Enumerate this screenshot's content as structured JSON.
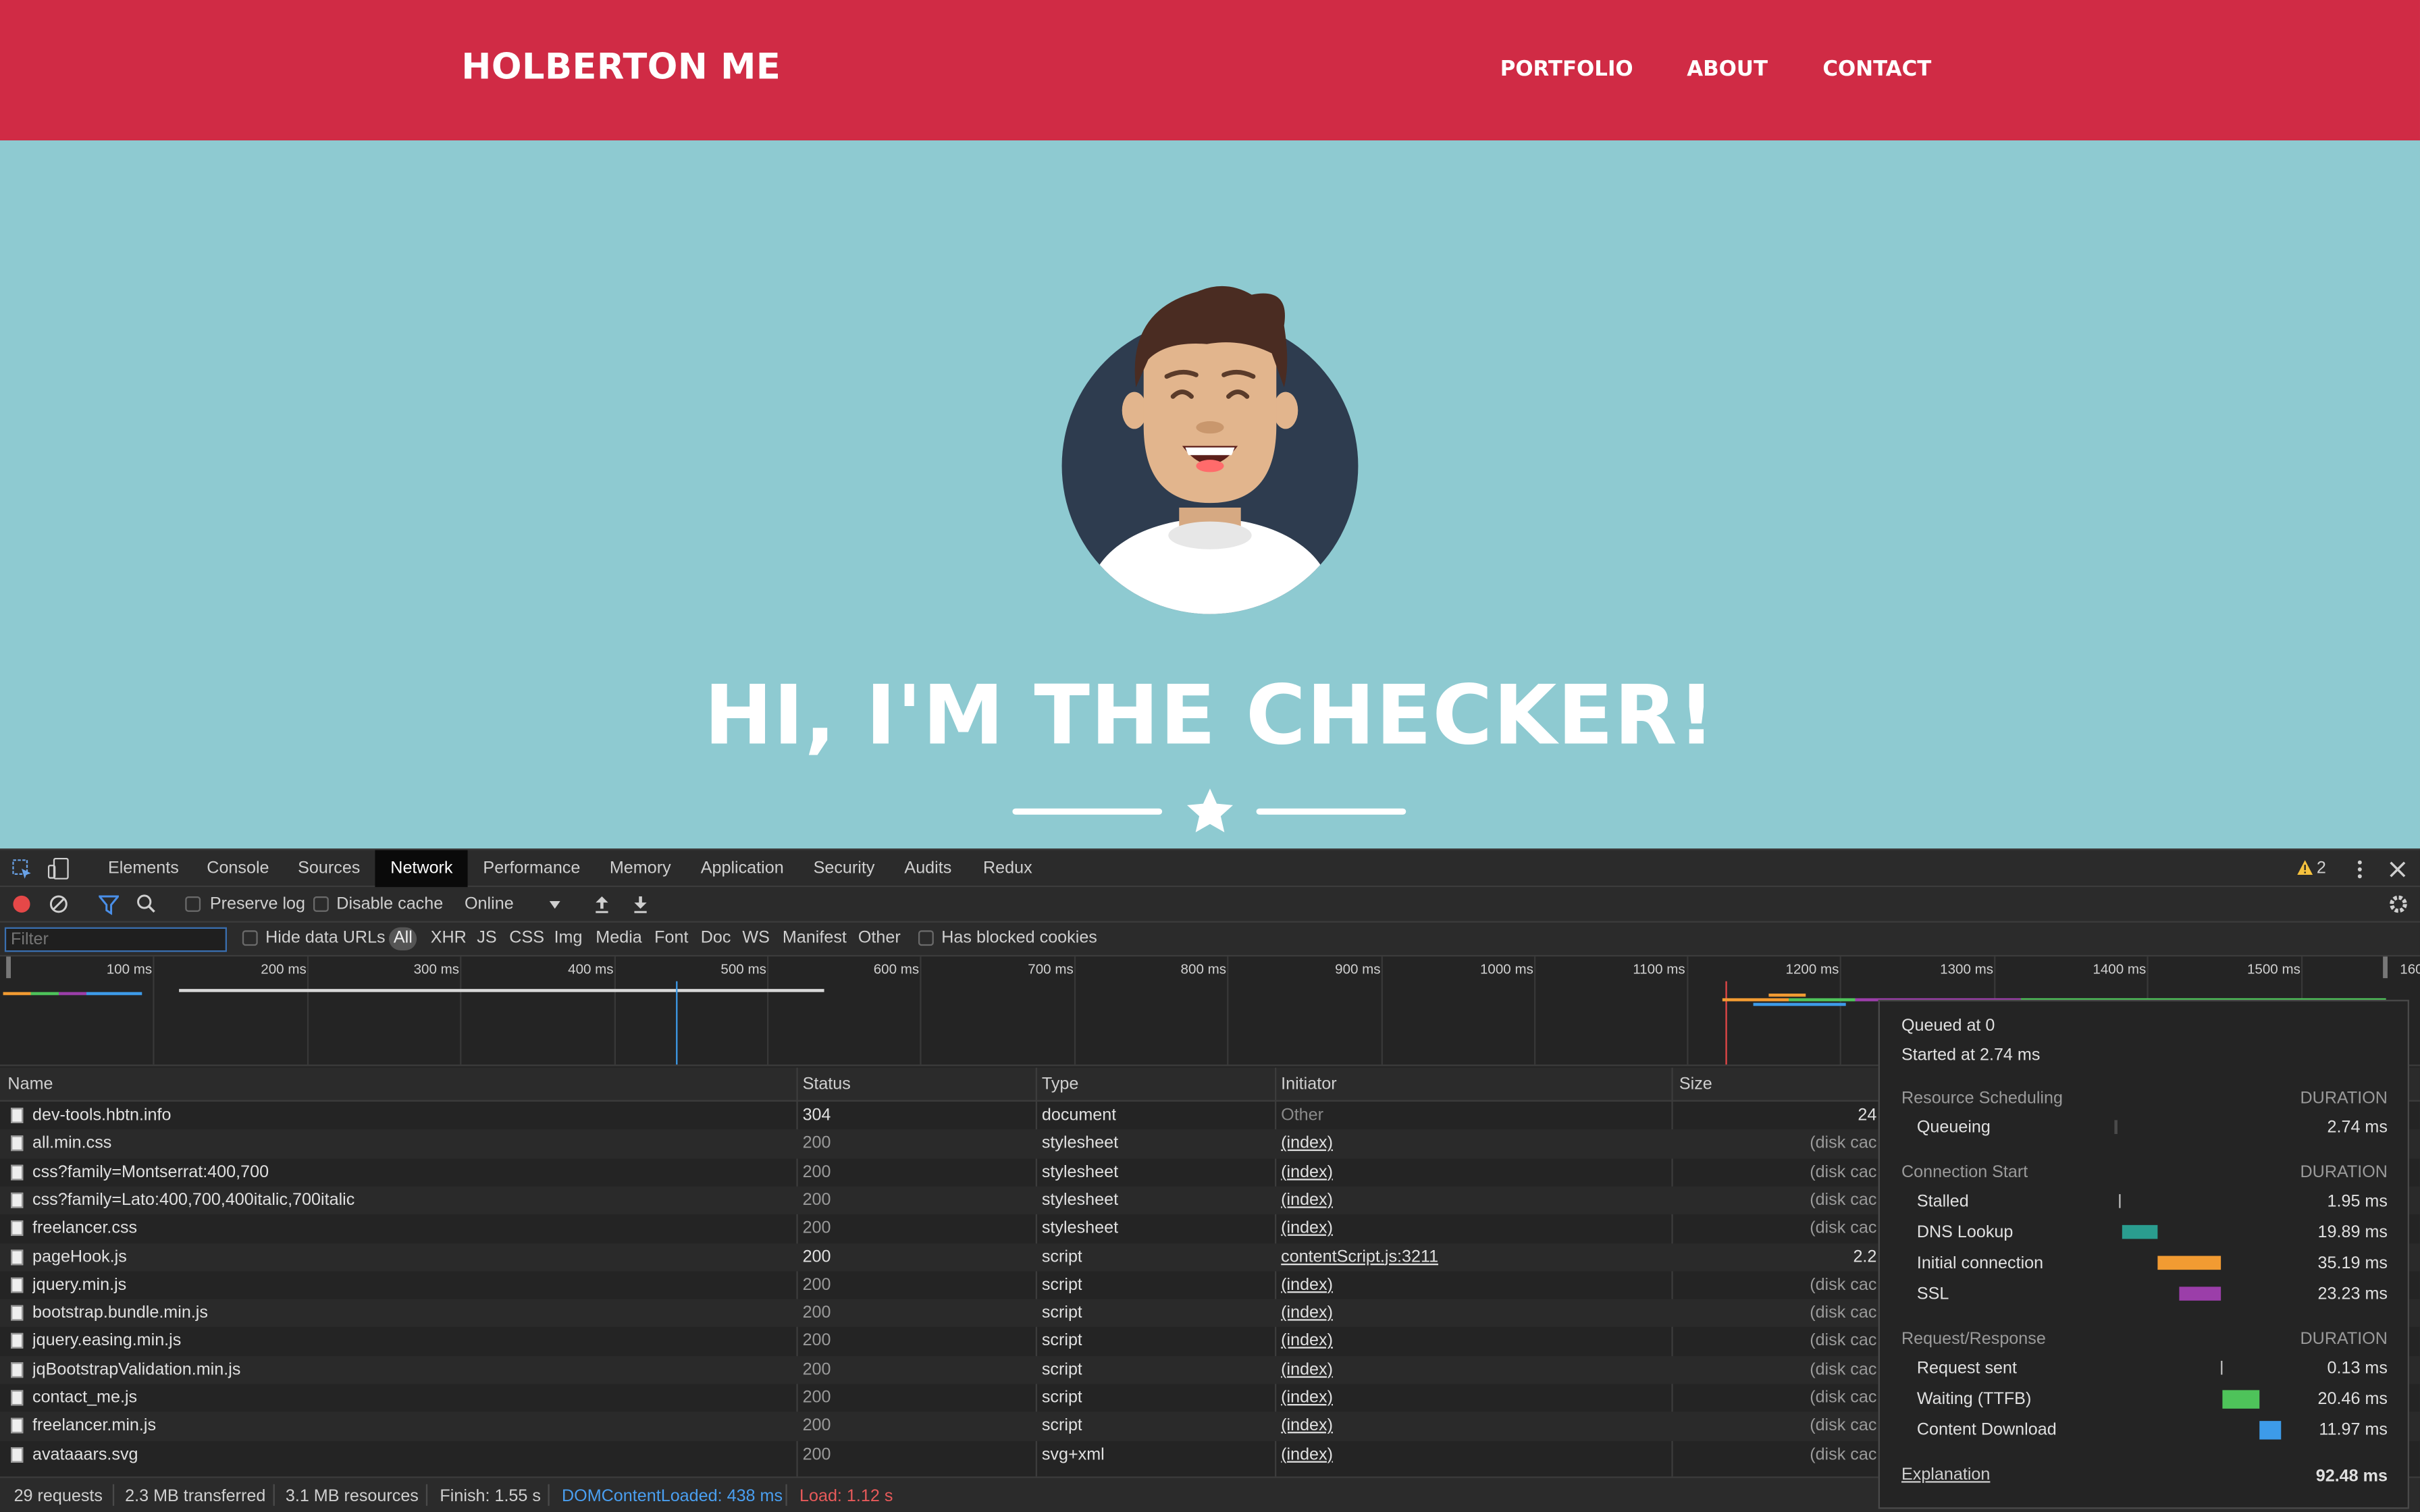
{
  "site": {
    "brand": "HOLBERTON ME",
    "nav": [
      "PORTFOLIO",
      "ABOUT",
      "CONTACT"
    ],
    "hero_title": "HI, I'M THE CHECKER!",
    "colors": {
      "header": "#d02b45",
      "hero_bg": "#8ecad1"
    }
  },
  "devtools": {
    "tabs": [
      "Elements",
      "Console",
      "Sources",
      "Network",
      "Performance",
      "Memory",
      "Application",
      "Security",
      "Audits",
      "Redux"
    ],
    "active_tab": "Network",
    "warning_count": "2",
    "toolbar": {
      "preserve_log": "Preserve log",
      "disable_cache": "Disable cache",
      "throttle": "Online"
    },
    "filter": {
      "placeholder": "Filter",
      "hide_data_urls": "Hide data URLs",
      "types": [
        "All",
        "XHR",
        "JS",
        "CSS",
        "Img",
        "Media",
        "Font",
        "Doc",
        "WS",
        "Manifest",
        "Other"
      ],
      "has_blocked_cookies": "Has blocked cookies"
    },
    "overview_ticks": [
      "100 ms",
      "200 ms",
      "300 ms",
      "400 ms",
      "500 ms",
      "600 ms",
      "700 ms",
      "800 ms",
      "900 ms",
      "1000 ms",
      "1100 ms",
      "1200 ms",
      "1300 ms",
      "1400 ms",
      "1500 ms",
      "160"
    ],
    "columns": [
      "Name",
      "Status",
      "Type",
      "Initiator",
      "Size"
    ],
    "requests": [
      {
        "name": "dev-tools.hbtn.info",
        "status": "304",
        "type": "document",
        "initiator": "Other",
        "size": "24"
      },
      {
        "name": "all.min.css",
        "status": "200",
        "type": "stylesheet",
        "initiator": "(index)",
        "size": "(disk cac"
      },
      {
        "name": "css?family=Montserrat:400,700",
        "status": "200",
        "type": "stylesheet",
        "initiator": "(index)",
        "size": "(disk cac"
      },
      {
        "name": "css?family=Lato:400,700,400italic,700italic",
        "status": "200",
        "type": "stylesheet",
        "initiator": "(index)",
        "size": "(disk cac"
      },
      {
        "name": "freelancer.css",
        "status": "200",
        "type": "stylesheet",
        "initiator": "(index)",
        "size": "(disk cac"
      },
      {
        "name": "pageHook.js",
        "status": "200",
        "type": "script",
        "initiator": "contentScript.js:3211",
        "size": "2.2"
      },
      {
        "name": "jquery.min.js",
        "status": "200",
        "type": "script",
        "initiator": "(index)",
        "size": "(disk cac"
      },
      {
        "name": "bootstrap.bundle.min.js",
        "status": "200",
        "type": "script",
        "initiator": "(index)",
        "size": "(disk cac"
      },
      {
        "name": "jquery.easing.min.js",
        "status": "200",
        "type": "script",
        "initiator": "(index)",
        "size": "(disk cac"
      },
      {
        "name": "jqBootstrapValidation.min.js",
        "status": "200",
        "type": "script",
        "initiator": "(index)",
        "size": "(disk cac"
      },
      {
        "name": "contact_me.js",
        "status": "200",
        "type": "script",
        "initiator": "(index)",
        "size": "(disk cac"
      },
      {
        "name": "freelancer.min.js",
        "status": "200",
        "type": "script",
        "initiator": "(index)",
        "size": "(disk cac"
      },
      {
        "name": "avataaars.svg",
        "status": "200",
        "type": "svg+xml",
        "initiator": "(index)",
        "size": "(disk cac"
      }
    ],
    "summary": {
      "requests": "29 requests",
      "transferred": "2.3 MB transferred",
      "resources": "3.1 MB resources",
      "finish": "Finish: 1.55 s",
      "dom_content_loaded": "DOMContentLoaded: 438 ms",
      "load": "Load: 1.12 s"
    },
    "timing": {
      "queued_at": "Queued at 0",
      "started_at": "Started at 2.74 ms",
      "duration_label": "DURATION",
      "sections": [
        {
          "title": "Resource Scheduling",
          "rows": [
            {
              "label": "Queueing",
              "value": "2.74 ms",
              "color": "#4a4a4a"
            }
          ]
        },
        {
          "title": "Connection Start",
          "rows": [
            {
              "label": "Stalled",
              "value": "1.95 ms",
              "color": "#bdbdbd"
            },
            {
              "label": "DNS Lookup",
              "value": "19.89 ms",
              "color": "#2a9d8f"
            },
            {
              "label": "Initial connection",
              "value": "35.19 ms",
              "color": "#f29b32"
            },
            {
              "label": "SSL",
              "value": "23.23 ms",
              "color": "#9b3ea9"
            }
          ]
        },
        {
          "title": "Request/Response",
          "rows": [
            {
              "label": "Request sent",
              "value": "0.13 ms",
              "color": "#bdbdbd"
            },
            {
              "label": "Waiting (TTFB)",
              "value": "20.46 ms",
              "color": "#4ec35a"
            },
            {
              "label": "Content Download",
              "value": "11.97 ms",
              "color": "#3d9be9"
            }
          ]
        }
      ],
      "explanation": "Explanation",
      "total": "92.48 ms"
    }
  }
}
